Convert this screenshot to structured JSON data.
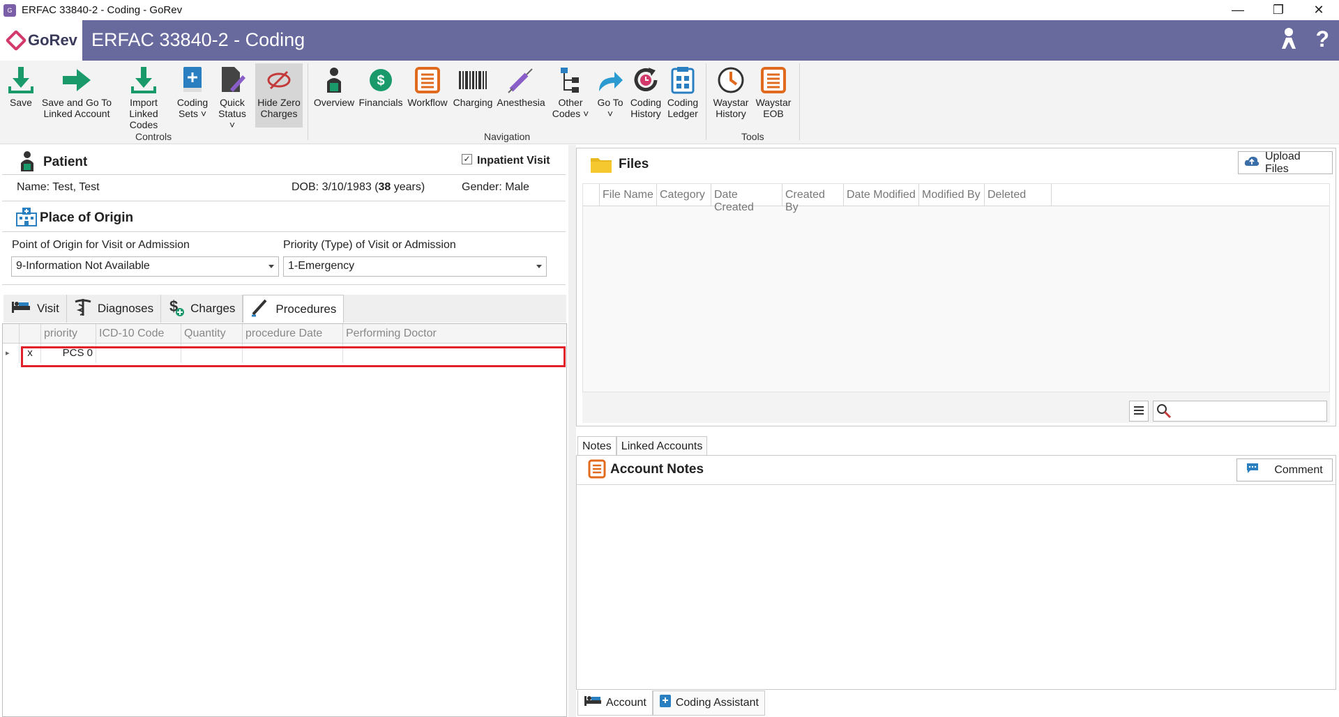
{
  "window": {
    "title": "ERFAC 33840-2 - Coding - GoRev",
    "icon": "app-icon",
    "controls": [
      "minimize-icon",
      "restore-icon",
      "close-icon"
    ]
  },
  "header": {
    "logo_text": "GoRev",
    "title": "ERFAC 33840-2 - Coding",
    "icons": [
      "user-key-icon",
      "help-icon"
    ],
    "help_glyph": "?"
  },
  "ribbon": {
    "groups": [
      {
        "label": "Controls"
      },
      {
        "label": "Navigation"
      },
      {
        "label": "Tools"
      }
    ],
    "buttons": {
      "save": "Save",
      "save_go_1": "Save and Go To",
      "save_go_2": "Linked Account",
      "import_1": "Import",
      "import_2": "Linked Codes",
      "coding_sets_1": "Coding",
      "coding_sets_2": "Sets",
      "quick_status_1": "Quick",
      "quick_status_2": "Status",
      "hide_zero_1": "Hide Zero",
      "hide_zero_2": "Charges",
      "overview": "Overview",
      "financials": "Financials",
      "workflow": "Workflow",
      "charging": "Charging",
      "anesthesia": "Anesthesia",
      "other_codes_1": "Other",
      "other_codes_2": "Codes",
      "go_to": "Go To",
      "coding_history_1": "Coding",
      "coding_history_2": "History",
      "coding_ledger_1": "Coding",
      "coding_ledger_2": "Ledger",
      "waystar_history_1": "Waystar",
      "waystar_history_2": "History",
      "waystar_eob_1": "Waystar",
      "waystar_eob_2": "EOB"
    },
    "colors": {
      "green": "#1a9a6a",
      "orange": "#e06a1e",
      "blue": "#2a7fc0",
      "purple": "#8a5ec8"
    }
  },
  "patient": {
    "section_title": "Patient",
    "inpatient_label": "Inpatient Visit",
    "inpatient_checked": true,
    "name": "Name: Test, Test",
    "dob_prefix": "DOB: 3/10/1983 (",
    "age": "38",
    "dob_suffix": " years)",
    "gender": "Gender: Male"
  },
  "origin": {
    "section_title": "Place of Origin",
    "point_label": "Point of Origin for Visit or Admission",
    "point_value": "9-Information Not Available",
    "priority_label": "Priority (Type) of Visit or Admission",
    "priority_value": "1-Emergency"
  },
  "left_tabs": {
    "visit": "Visit",
    "diagnoses": "Diagnoses",
    "charges": "Charges",
    "procedures": "Procedures",
    "selected": "Procedures"
  },
  "procedures_grid": {
    "columns": [
      "priority",
      "ICD-10 Code",
      "Quantity",
      "procedure Date",
      "Performing Doctor"
    ],
    "rows": [
      {
        "marker": "x",
        "priority": "PCS 0",
        "icd": "",
        "quantity": "",
        "date": "",
        "doctor": ""
      }
    ]
  },
  "files": {
    "title": "Files",
    "upload_label": "Upload Files",
    "columns": [
      "File Name",
      "Category",
      "Date Created",
      "Created By",
      "Date Modified",
      "Modified By",
      "Deleted"
    ],
    "search_placeholder": ""
  },
  "notes": {
    "tabs": [
      "Notes",
      "Linked Accounts"
    ],
    "selected_tab": "Notes",
    "title": "Account Notes",
    "comment_label": "Comment"
  },
  "bottom_tabs": {
    "account": "Account",
    "coding_assistant": "Coding Assistant",
    "selected": "Account"
  }
}
